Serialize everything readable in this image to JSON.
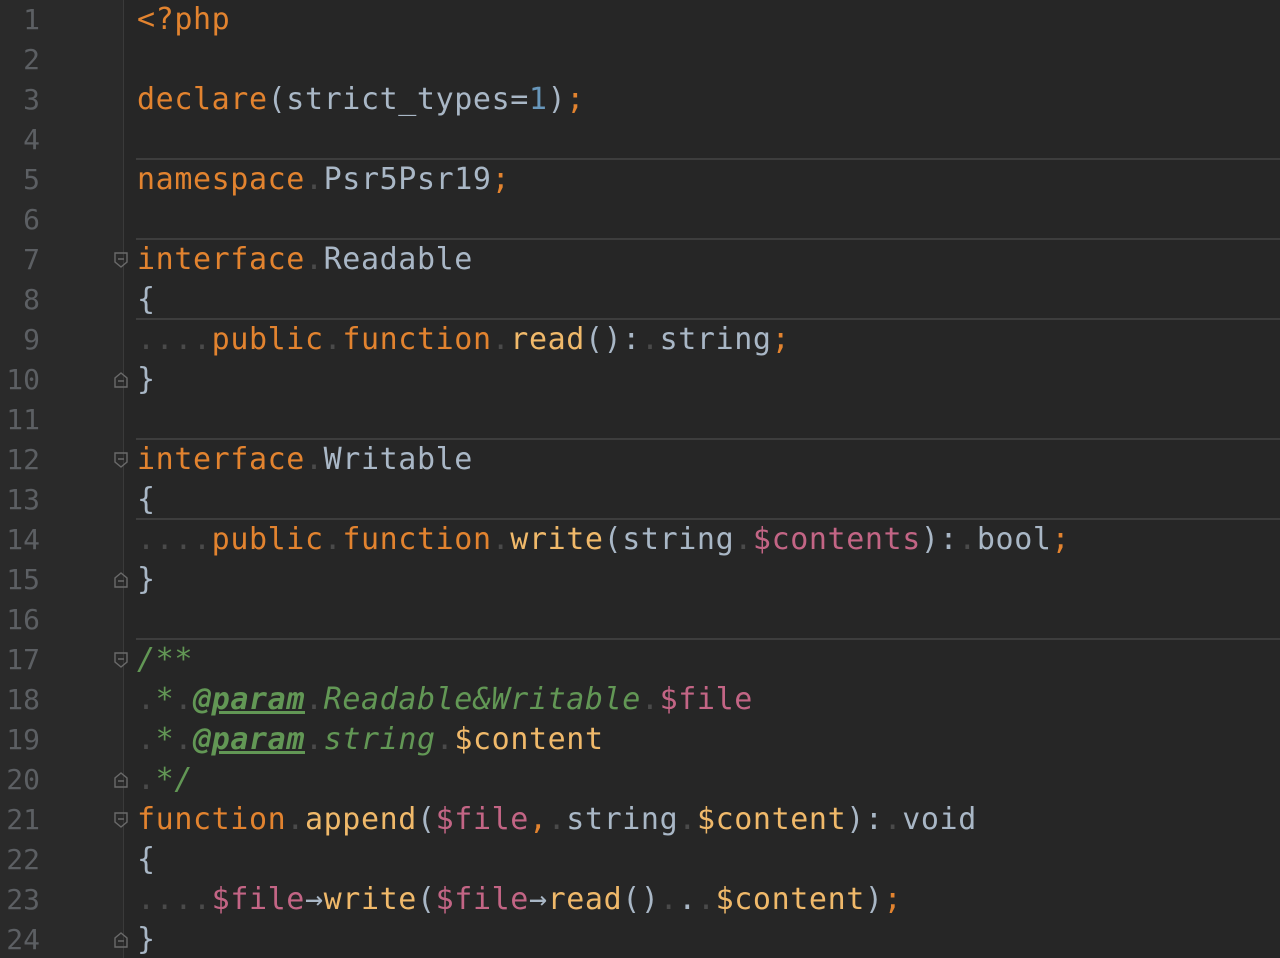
{
  "editor": {
    "language": "php",
    "colors": {
      "background": "#262626",
      "keyword": "#e2832f",
      "function": "#f0b96a",
      "variable": "#c36585",
      "number": "#6897bb",
      "comment": "#629755",
      "text": "#a9b7c6",
      "line_number": "#5c5f63"
    },
    "lines": [
      {
        "n": "1",
        "tokens": [
          [
            "kw",
            "<?php"
          ]
        ]
      },
      {
        "n": "2",
        "tokens": []
      },
      {
        "n": "3",
        "tokens": [
          [
            "kw",
            "declare"
          ],
          [
            "plain",
            "(strict_types="
          ],
          [
            "num",
            "1"
          ],
          [
            "plain",
            ")"
          ],
          [
            "semi",
            ";"
          ]
        ]
      },
      {
        "n": "4",
        "tokens": []
      },
      {
        "n": "5",
        "tokens": [
          [
            "kw",
            "namespace"
          ],
          [
            "ws",
            "."
          ],
          [
            "plain",
            "Psr5Psr19"
          ],
          [
            "semi",
            ";"
          ]
        ]
      },
      {
        "n": "6",
        "tokens": []
      },
      {
        "n": "7",
        "tokens": [
          [
            "kw",
            "interface"
          ],
          [
            "ws",
            "."
          ],
          [
            "plain",
            "Readable"
          ]
        ]
      },
      {
        "n": "8",
        "tokens": [
          [
            "plain",
            "{"
          ]
        ]
      },
      {
        "n": "9",
        "tokens": [
          [
            "ws",
            "...."
          ],
          [
            "kw",
            "public"
          ],
          [
            "ws",
            "."
          ],
          [
            "kw",
            "function"
          ],
          [
            "ws",
            "."
          ],
          [
            "fn",
            "read"
          ],
          [
            "plain",
            "():"
          ],
          [
            "ws",
            "."
          ],
          [
            "plain",
            "string"
          ],
          [
            "semi",
            ";"
          ]
        ]
      },
      {
        "n": "10",
        "tokens": [
          [
            "plain",
            "}"
          ]
        ]
      },
      {
        "n": "11",
        "tokens": []
      },
      {
        "n": "12",
        "tokens": [
          [
            "kw",
            "interface"
          ],
          [
            "ws",
            "."
          ],
          [
            "plain",
            "Writable"
          ]
        ]
      },
      {
        "n": "13",
        "tokens": [
          [
            "plain",
            "{"
          ]
        ]
      },
      {
        "n": "14",
        "tokens": [
          [
            "ws",
            "...."
          ],
          [
            "kw",
            "public"
          ],
          [
            "ws",
            "."
          ],
          [
            "kw",
            "function"
          ],
          [
            "ws",
            "."
          ],
          [
            "fn",
            "write"
          ],
          [
            "plain",
            "(string"
          ],
          [
            "ws",
            "."
          ],
          [
            "var",
            "$contents"
          ],
          [
            "plain",
            "):"
          ],
          [
            "ws",
            "."
          ],
          [
            "plain",
            "bool"
          ],
          [
            "semi",
            ";"
          ]
        ]
      },
      {
        "n": "15",
        "tokens": [
          [
            "plain",
            "}"
          ]
        ]
      },
      {
        "n": "16",
        "tokens": []
      },
      {
        "n": "17",
        "tokens": [
          [
            "cm",
            "/**"
          ]
        ]
      },
      {
        "n": "18",
        "tokens": [
          [
            "ws",
            "."
          ],
          [
            "cm",
            "*"
          ],
          [
            "ws",
            "."
          ],
          [
            "tag",
            "@param"
          ],
          [
            "ws",
            "."
          ],
          [
            "cm",
            "Readable&Writable"
          ],
          [
            "ws",
            "."
          ],
          [
            "var",
            "$file"
          ]
        ]
      },
      {
        "n": "19",
        "tokens": [
          [
            "ws",
            "."
          ],
          [
            "cm",
            "*"
          ],
          [
            "ws",
            "."
          ],
          [
            "tag",
            "@param"
          ],
          [
            "ws",
            "."
          ],
          [
            "cm",
            "string"
          ],
          [
            "ws",
            "."
          ],
          [
            "fn",
            "$content"
          ]
        ]
      },
      {
        "n": "20",
        "tokens": [
          [
            "ws",
            "."
          ],
          [
            "cm",
            "*/"
          ]
        ]
      },
      {
        "n": "21",
        "tokens": [
          [
            "kw",
            "function"
          ],
          [
            "ws",
            "."
          ],
          [
            "fn",
            "append"
          ],
          [
            "plain",
            "("
          ],
          [
            "var",
            "$file"
          ],
          [
            "kw",
            ","
          ],
          [
            "ws",
            "."
          ],
          [
            "plain",
            "string"
          ],
          [
            "ws",
            "."
          ],
          [
            "fn",
            "$content"
          ],
          [
            "plain",
            "):"
          ],
          [
            "ws",
            "."
          ],
          [
            "plain",
            "void"
          ]
        ]
      },
      {
        "n": "22",
        "tokens": [
          [
            "plain",
            "{"
          ]
        ]
      },
      {
        "n": "23",
        "tokens": [
          [
            "ws",
            "...."
          ],
          [
            "var",
            "$file"
          ],
          [
            "plain",
            "→"
          ],
          [
            "fn",
            "write"
          ],
          [
            "plain",
            "("
          ],
          [
            "var",
            "$file"
          ],
          [
            "plain",
            "→"
          ],
          [
            "fn",
            "read"
          ],
          [
            "plain",
            "()"
          ],
          [
            "ws",
            "."
          ],
          [
            "plain",
            "."
          ],
          [
            "ws",
            "."
          ],
          [
            "fn",
            "$content"
          ],
          [
            "plain",
            ")"
          ],
          [
            "semi",
            ";"
          ]
        ]
      },
      {
        "n": "24",
        "tokens": [
          [
            "plain",
            "}"
          ]
        ]
      }
    ]
  }
}
